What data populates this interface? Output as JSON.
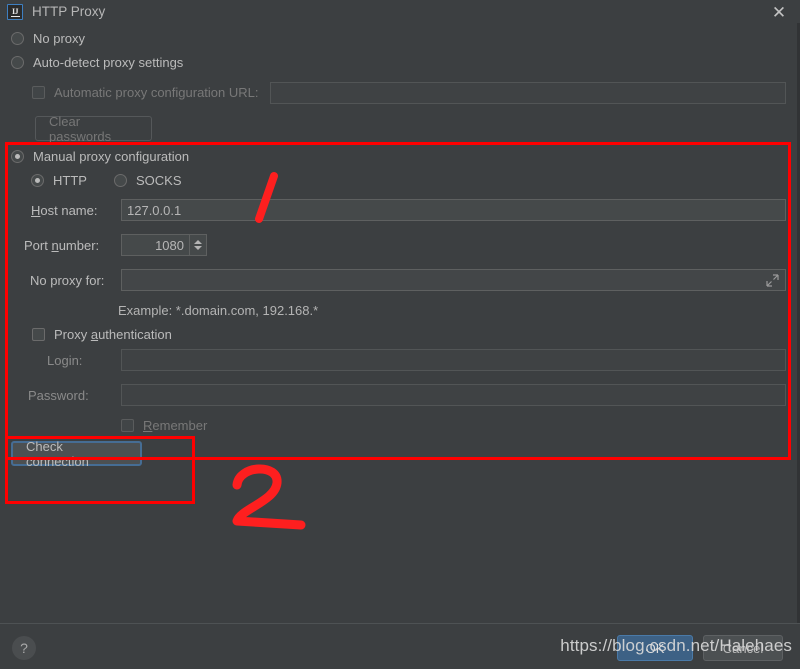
{
  "window": {
    "title": "HTTP Proxy",
    "app_icon": "intellij-idea-icon",
    "close_icon": "close-icon"
  },
  "options": {
    "no_proxy": {
      "label": "No proxy",
      "selected": false
    },
    "auto_detect": {
      "label": "Auto-detect proxy settings",
      "selected": false
    },
    "auto_config_url": {
      "label": "Automatic proxy configuration URL:",
      "checked": false,
      "enabled": false,
      "value": ""
    },
    "clear_passwords": {
      "label": "Clear passwords",
      "enabled": false
    },
    "manual": {
      "label": "Manual proxy configuration",
      "selected": true
    }
  },
  "manual": {
    "protocol": {
      "http": {
        "label": "HTTP",
        "selected": true
      },
      "socks": {
        "label": "SOCKS",
        "selected": false
      }
    },
    "host": {
      "label": "Host name:",
      "mnemonic": "H",
      "value": "127.0.0.1"
    },
    "port": {
      "label": "Port number:",
      "mnemonic": "n",
      "value": "1080"
    },
    "no_proxy_for": {
      "label": "No proxy for:",
      "value": "",
      "expand_icon": "expand-icon"
    },
    "example_hint": "Example: *.domain.com, 192.168.*",
    "auth": {
      "label": "Proxy authentication",
      "mnemonic": "a",
      "checked": false,
      "login": {
        "label": "Login:",
        "value": "",
        "enabled": false
      },
      "password": {
        "label": "Password:",
        "value": "",
        "enabled": false
      },
      "remember": {
        "label": "Remember",
        "mnemonic": "R",
        "checked": false,
        "enabled": false
      }
    }
  },
  "actions": {
    "check_connection": {
      "label": "Check connection",
      "focused": true
    }
  },
  "footer": {
    "help_label": "?",
    "ok_label": "OK",
    "cancel_label": "Cancel"
  },
  "annotations": {
    "marker_one": "1",
    "marker_two": "2",
    "box_color": "#fe0000"
  },
  "watermark": {
    "text": "https://blog.csdn.net/Halehaes"
  },
  "colors": {
    "background": "#3c3f41",
    "field_background": "#45494a",
    "text": "#bbbbbb",
    "disabled_text": "#787878",
    "accent_blue": "#3d6185",
    "annotation_red": "#fe0000"
  }
}
